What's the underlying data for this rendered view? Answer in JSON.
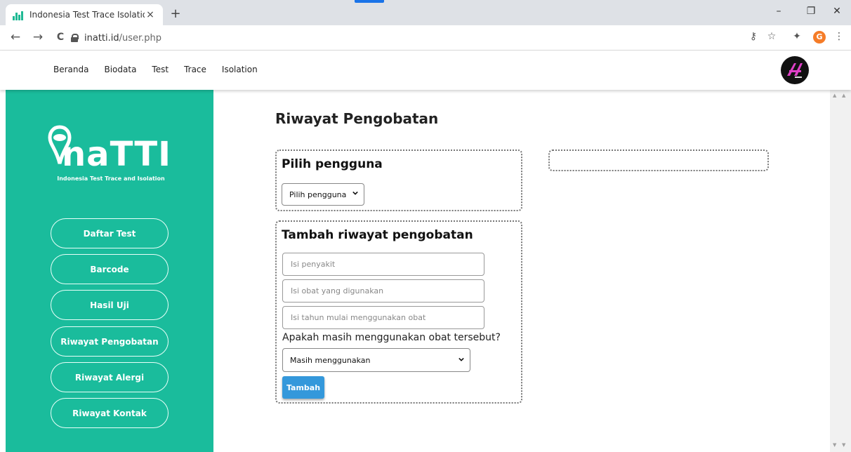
{
  "browser": {
    "tab_title": "Indonesia Test Trace Isolation",
    "tab_close": "×",
    "new_tab": "+",
    "url_host": "inatti.id",
    "url_path": "/user.php",
    "profile_initial": "G",
    "window_controls": {
      "minimize": "–",
      "restore": "❐",
      "close": "✕"
    },
    "nav": {
      "back": "←",
      "forward": "→",
      "reload": "C"
    },
    "toolbar_icons": {
      "key": "⚷",
      "star": "☆",
      "extension": "✦",
      "menu": "⋮"
    }
  },
  "site_nav": {
    "items": [
      "Beranda",
      "Biodata",
      "Test",
      "Trace",
      "Isolation"
    ]
  },
  "sidebar": {
    "logo_text": "naTTI",
    "logo_subtitle": "Indonesia Test Trace and Isolation",
    "items": [
      "Daftar Test",
      "Barcode",
      "Hasil Uji",
      "Riwayat Pengobatan",
      "Riwayat Alergi",
      "Riwayat Kontak"
    ]
  },
  "main": {
    "page_title": "Riwayat Pengobatan",
    "user_box": {
      "title": "Pilih pengguna",
      "select_value": "Pilih pengguna"
    },
    "add_box": {
      "title": "Tambah riwayat pengobatan",
      "disease_placeholder": "Isi penyakit",
      "medicine_placeholder": "Isi obat yang digunakan",
      "year_placeholder": "Isi tahun mulai menggunakan obat",
      "question": "Apakah masih menggunakan obat tersebut?",
      "status_value": "Masih menggunakan",
      "submit_label": "Tambah"
    }
  },
  "colors": {
    "sidebar": "#1abc9c",
    "button": "#3498db",
    "chrome_tabstrip": "#dee1e6"
  },
  "icons": [
    "key-icon",
    "star-icon",
    "extension-icon",
    "menu-icon",
    "lock-icon",
    "chevron-down-icon"
  ]
}
